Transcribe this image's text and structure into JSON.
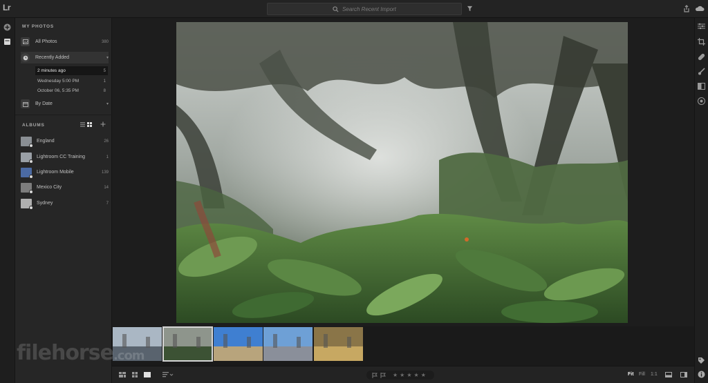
{
  "app": {
    "logo_text": "Lr"
  },
  "search": {
    "placeholder": "Search Recent Import"
  },
  "left_panel": {
    "my_photos_header": "MY PHOTOS",
    "all_photos": {
      "label": "All Photos",
      "count": "380"
    },
    "recently_added": {
      "label": "Recently Added"
    },
    "recent_items": [
      {
        "label": "2 minutes ago",
        "count": "5"
      },
      {
        "label": "Wednesday  5:00 PM",
        "count": "1"
      },
      {
        "label": "October 06, 5:35 PM",
        "count": "8"
      }
    ],
    "by_date": {
      "label": "By Date"
    },
    "albums_header": "ALBUMS",
    "albums": [
      {
        "label": "England",
        "count": "26",
        "color": "#8a8f94"
      },
      {
        "label": "Lightroom CC Training",
        "count": "1",
        "color": "#9aa0a6"
      },
      {
        "label": "Lightroom Mobile",
        "count": "139",
        "color": "#4b6aa3"
      },
      {
        "label": "Mexico City",
        "count": "14",
        "color": "#7d7d7d"
      },
      {
        "label": "Sydney",
        "count": "7",
        "color": "#b0b0b0"
      }
    ]
  },
  "filmstrip": {
    "items": [
      {
        "name": "tower-bridge",
        "sky": "#aab7c4",
        "ground": "#59636e"
      },
      {
        "name": "misty-forest",
        "sky": "#8e958c",
        "ground": "#3c5234"
      },
      {
        "name": "venice-campanile",
        "sky": "#3f7fd1",
        "ground": "#b8a47c"
      },
      {
        "name": "venice-canal",
        "sky": "#6ea0d6",
        "ground": "#8a8f9a"
      },
      {
        "name": "colonnade",
        "sky": "#8a7548",
        "ground": "#c7a862"
      }
    ]
  },
  "bottom_bar": {
    "zoom_fit": "Fit",
    "zoom_fill": "Fill",
    "zoom_1to1": "1:1",
    "stars": [
      "★",
      "★",
      "★",
      "★",
      "★"
    ]
  },
  "watermark": {
    "main": "filehorse",
    "suffix": ".com"
  },
  "colors": {
    "accent": "#d6d6d6",
    "panel": "#262626",
    "background": "#1d1d1d"
  }
}
